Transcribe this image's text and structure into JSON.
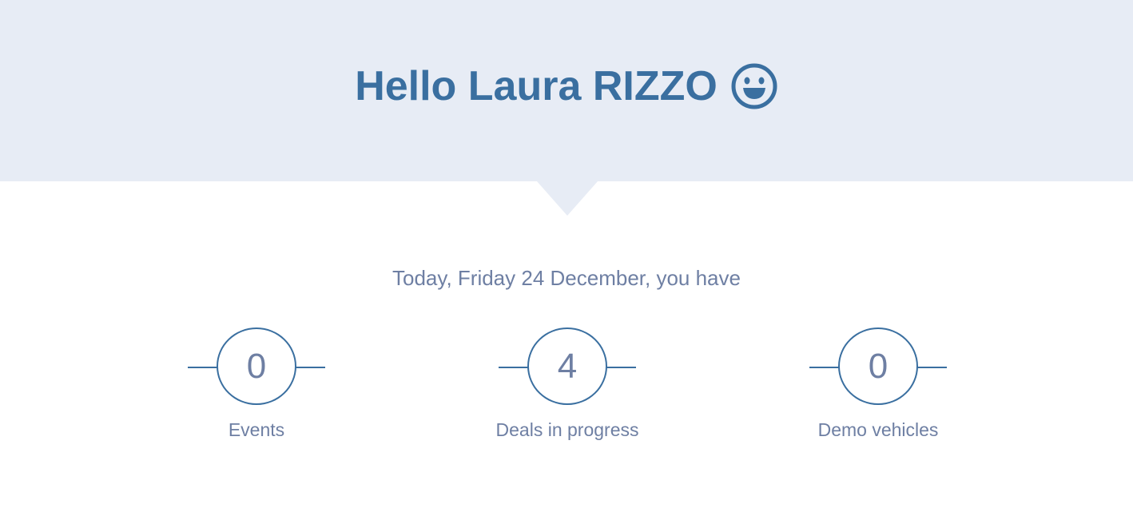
{
  "header": {
    "greeting": "Hello Laura RIZZO",
    "emoji_icon": "smiley-icon",
    "background_color": "#e7ecf5",
    "text_color": "#3a6fa0"
  },
  "summary": {
    "text": "Today, Friday 24 December, you have"
  },
  "stats": [
    {
      "value": "0",
      "label": "Events"
    },
    {
      "value": "4",
      "label": "Deals in progress"
    },
    {
      "value": "0",
      "label": "Demo vehicles"
    }
  ],
  "colors": {
    "accent": "#3a6fa0",
    "muted_text": "#6e7fa3"
  }
}
